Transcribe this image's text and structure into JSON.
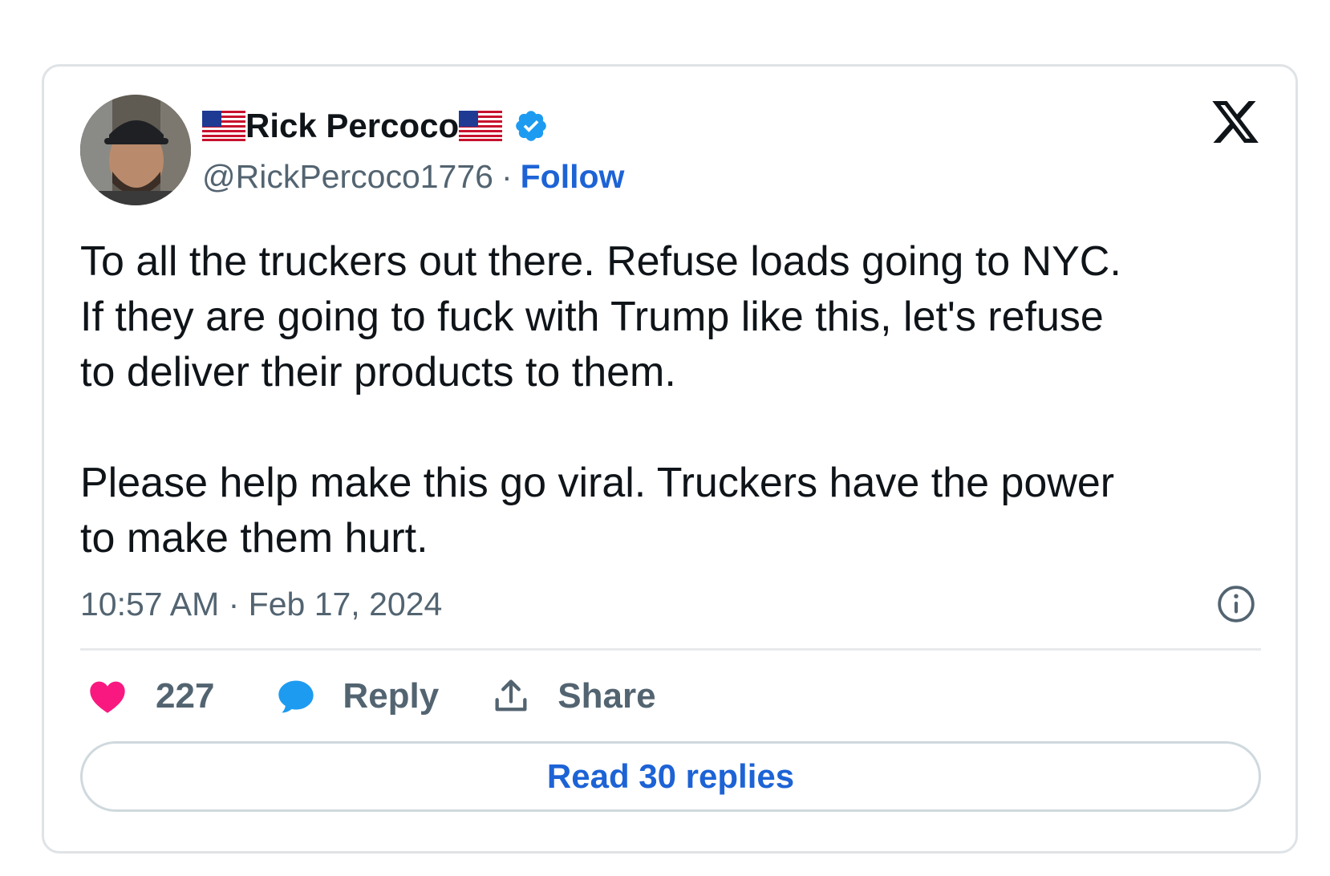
{
  "author": {
    "display_name": "Rick Percoco",
    "handle": "@RickPercoco1776",
    "follow_label": "Follow",
    "flag_icon": "us-flag-icon",
    "verified_icon": "verified-badge-icon",
    "verified_color": "#1d9bf0"
  },
  "platform": {
    "logo_icon": "x-logo-icon"
  },
  "tweet": {
    "paragraphs": [
      "To all the truckers out there. Refuse loads going to NYC.\nIf they are going to fuck with Trump like this, let's refuse\nto deliver their products to them.",
      "Please help make this go viral. Truckers have the power\nto make them hurt."
    ],
    "timestamp": "10:57 AM · Feb 17, 2024"
  },
  "actions": {
    "like_count": "227",
    "like_icon": "heart-icon",
    "like_color": "#f91880",
    "reply_label": "Reply",
    "reply_icon": "speech-bubble-icon",
    "reply_color": "#1d9bf0",
    "share_label": "Share",
    "share_icon": "share-upload-icon"
  },
  "read_replies_label": "Read 30 replies",
  "colors": {
    "link": "#1d63d6",
    "muted": "#536471",
    "text": "#0f1419"
  }
}
